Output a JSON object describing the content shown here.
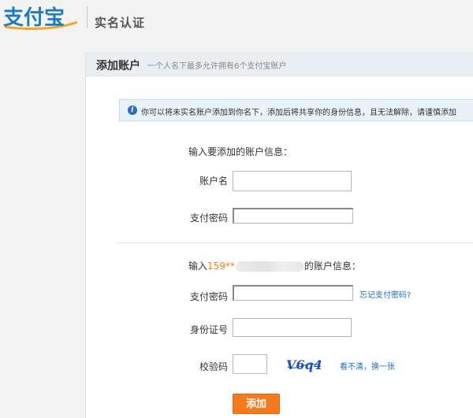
{
  "header": {
    "logo_text": "支付宝",
    "page_title": "实名认证"
  },
  "panel": {
    "title": "添加账户",
    "subtitle": "一个人名下最多允许拥有6个支付宝账户"
  },
  "notice": {
    "icon": "info-icon",
    "text": "你可以将未实名账户添加到你名下，添加后将共享你的身份信息，且无法解除，请谨慎添加"
  },
  "section1": {
    "heading": "输入要添加的账户信息：",
    "account_label": "账户名",
    "account_value": "",
    "password_label": "支付密码",
    "password_value": ""
  },
  "section2": {
    "heading_prefix": "输入",
    "phone_visible": "159**",
    "heading_suffix": "的账户信息：",
    "password_label": "支付密码",
    "password_value": "",
    "forgot_link": "忘记支付密码?",
    "id_label": "身份证号",
    "id_value": "",
    "captcha_label": "校验码",
    "captcha_value": "",
    "captcha_text": "V6q4",
    "refresh_link": "看不清，换一张"
  },
  "actions": {
    "add_label": "添加"
  },
  "colors": {
    "accent": "#f37b1d",
    "link": "#1f6cbf",
    "notice_bg": "#e8f2fb",
    "brand_blue": "#1d7bc4"
  }
}
